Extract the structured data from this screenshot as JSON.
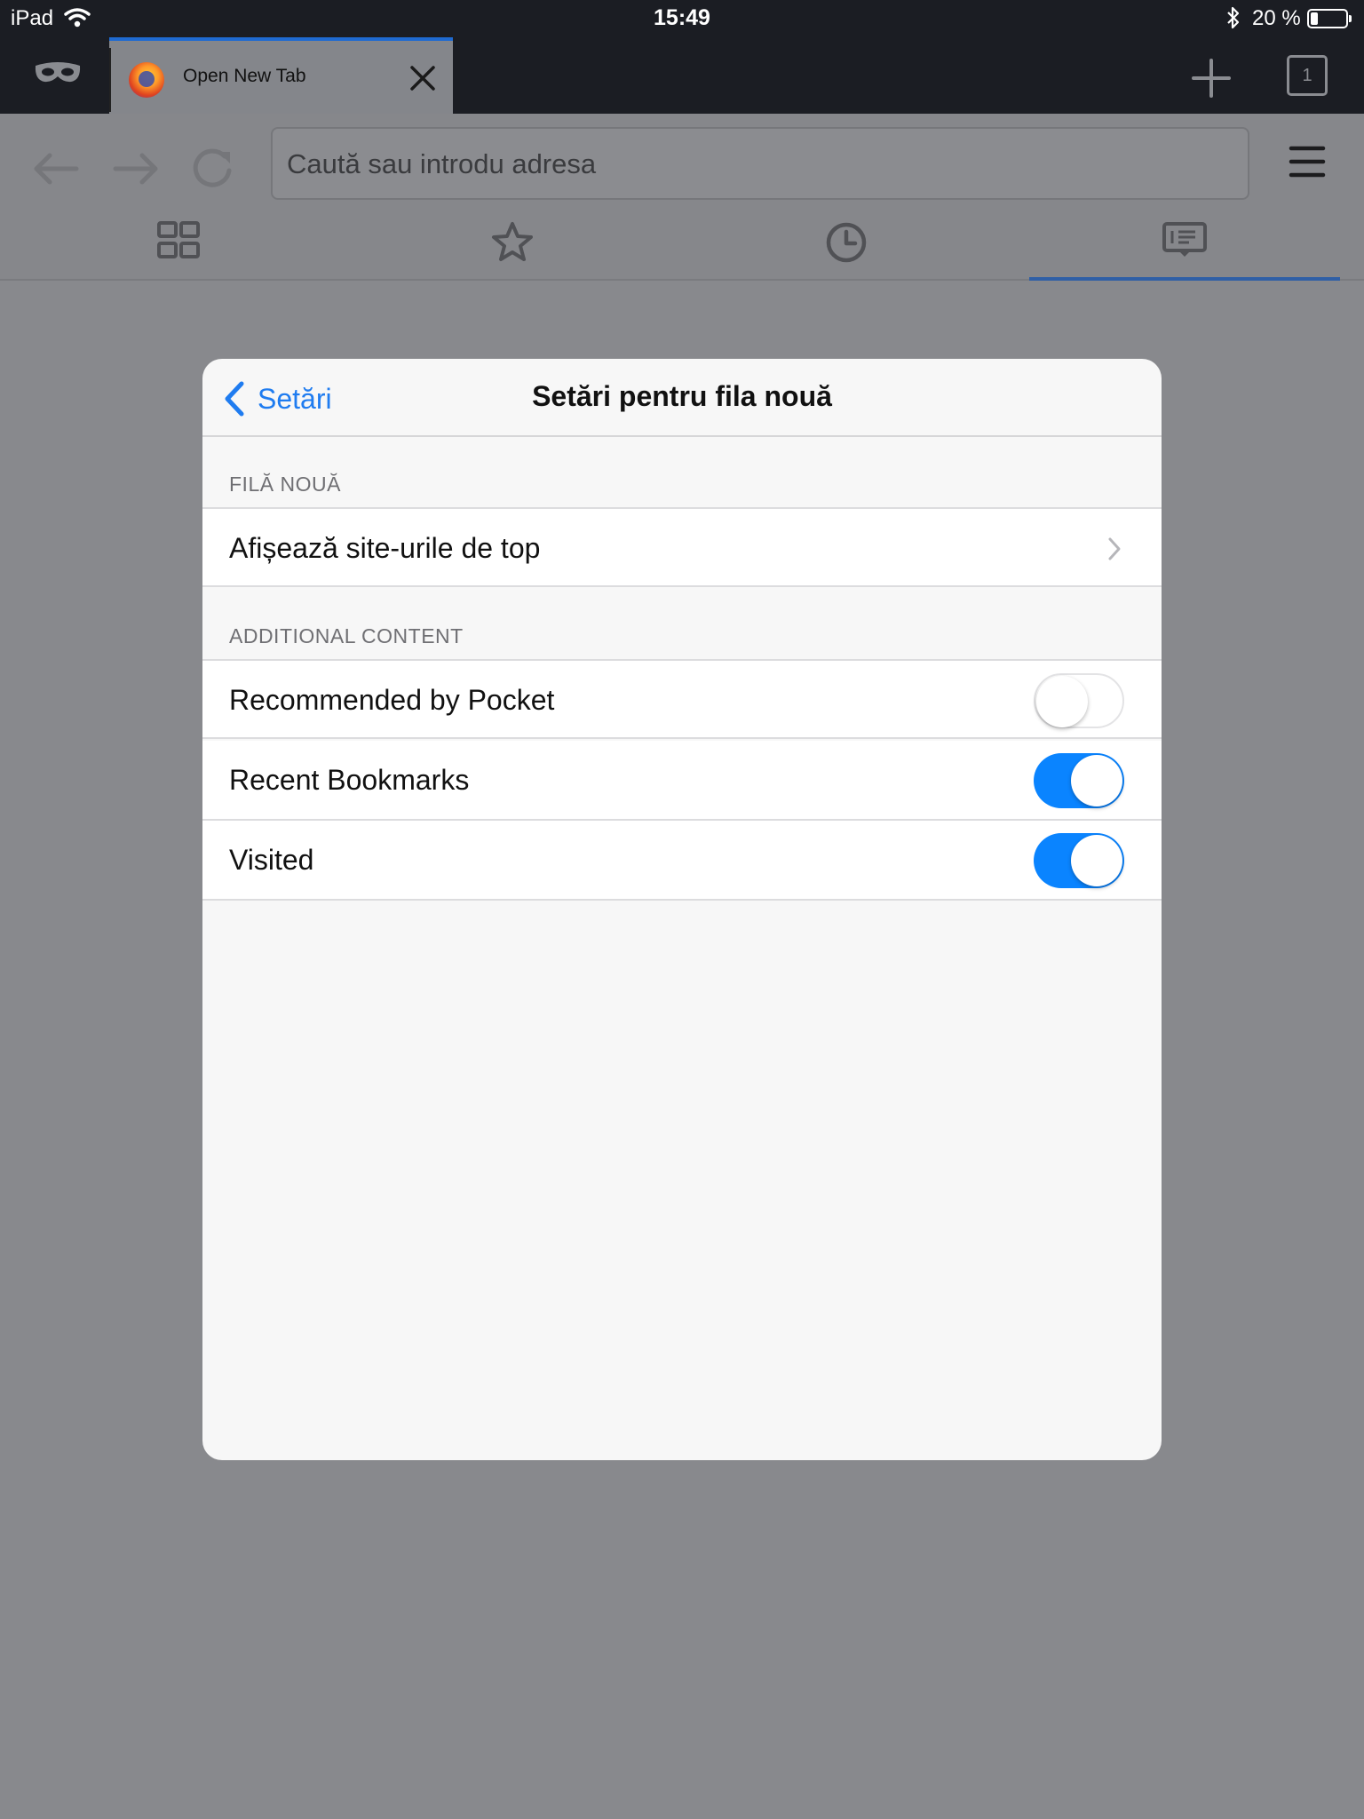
{
  "status_bar": {
    "carrier": "iPad",
    "time": "15:49",
    "battery": "20 %",
    "battery_level": 0.2
  },
  "tab_bar": {
    "tab_title": "Open New Tab",
    "tab_count": "1"
  },
  "toolbar": {
    "url_placeholder": "Caută sau introdu adresa"
  },
  "home_tabs": [
    {
      "icon": "top-sites-grid-icon",
      "active": false
    },
    {
      "icon": "bookmarks-star-icon",
      "active": false
    },
    {
      "icon": "history-clock-icon",
      "active": false
    },
    {
      "icon": "reading-list-icon",
      "active": true
    }
  ],
  "modal": {
    "back_label": "Setări",
    "title": "Setări pentru fila nouă",
    "sections": [
      {
        "header": "FILĂ NOUĂ",
        "rows": [
          {
            "label": "Afișează site-urile de top",
            "type": "disclosure"
          }
        ]
      },
      {
        "header": "ADDITIONAL CONTENT",
        "rows": [
          {
            "label": "Recommended by Pocket",
            "type": "toggle",
            "on": false
          },
          {
            "label": "Recent Bookmarks",
            "type": "toggle",
            "on": true
          },
          {
            "label": "Visited",
            "type": "toggle",
            "on": true
          }
        ]
      }
    ]
  },
  "colors": {
    "accent": "#0a84ff",
    "dim_background": "#88898d",
    "chrome_dark": "#1b1d23",
    "tab_indicator": "#1f6ad1"
  }
}
